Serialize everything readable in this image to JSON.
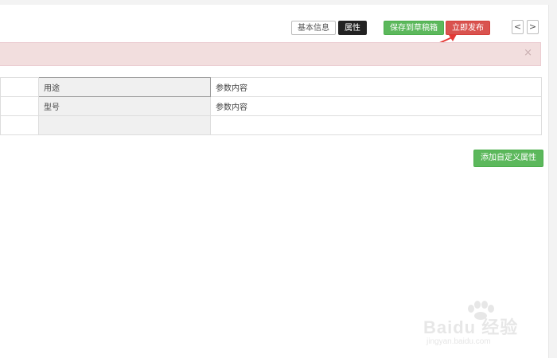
{
  "toolbar": {
    "basic_info_tab": "基本信息",
    "attributes_tab": "属性",
    "save_draft_label": "保存到草稿箱",
    "publish_label": "立即发布",
    "prev_symbol": "<",
    "next_symbol": ">"
  },
  "alert": {
    "close_symbol": "×"
  },
  "attributes_table": {
    "rows": [
      {
        "name": "用途",
        "value_placeholder": "参数内容"
      },
      {
        "name": "型号",
        "value_placeholder": "参数内容"
      },
      {
        "name": "",
        "value_placeholder": ""
      }
    ]
  },
  "add_custom_attribute_label": "添加自定义属性",
  "watermark": {
    "brand": "Baidu 经验",
    "url": "jingyan.baidu.com"
  },
  "colors": {
    "publish_red": "#d9534f",
    "save_green": "#5cb85c",
    "alert_bg": "#f2dede",
    "annotation_arrow": "#e53935"
  }
}
